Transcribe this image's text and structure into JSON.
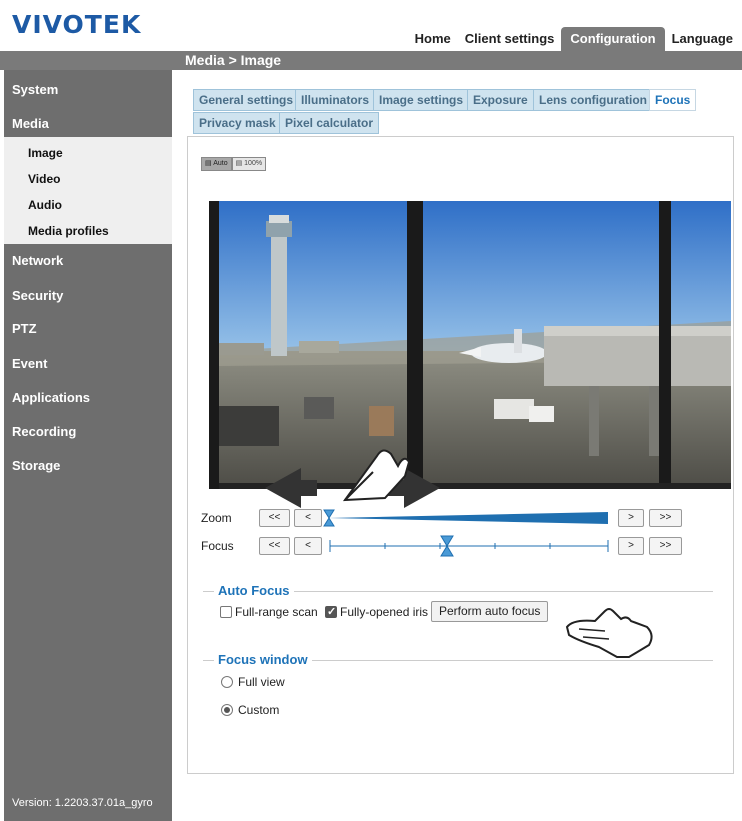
{
  "logo": "VIVOTEK",
  "topnav": [
    "Home",
    "Client settings",
    "Configuration",
    "Language"
  ],
  "breadcrumb": "Media  > Image",
  "sidebar": {
    "items": [
      "System",
      "Media",
      "Network",
      "Security",
      "PTZ",
      "Event",
      "Applications",
      "Recording",
      "Storage"
    ],
    "media_sub": [
      "Image",
      "Video",
      "Audio",
      "Media profiles"
    ],
    "version": "Version: 1.2203.37.01a_gyro"
  },
  "tabs": [
    "General settings",
    "Illuminators",
    "Image settings",
    "Exposure",
    "Lens configuration",
    "Focus",
    "Privacy mask",
    "Pixel calculator"
  ],
  "active_tab": "Focus",
  "view_buttons": [
    "Auto",
    "100%"
  ],
  "controls": {
    "zoom_label": "Zoom",
    "focus_label": "Focus",
    "step_back_fast": "<<",
    "step_back": "<",
    "step_fwd": ">",
    "step_fwd_fast": ">>",
    "zoom_level": 0,
    "focus_level": 0.42
  },
  "auto_focus": {
    "legend": "Auto Focus",
    "full_range_scan": "Full-range scan",
    "full_range_checked": false,
    "fully_opened_iris": "Fully-opened iris",
    "iris_checked": true,
    "perform_button": "Perform auto focus"
  },
  "focus_window": {
    "legend": "Focus window",
    "options": [
      "Full view",
      "Custom"
    ],
    "selected": "Custom"
  },
  "colors": {
    "accent": "#1e73b8",
    "sidebar": "#6e6e6e",
    "logo": "#1d5aa5",
    "tab_bg": "#cfe3ef"
  }
}
